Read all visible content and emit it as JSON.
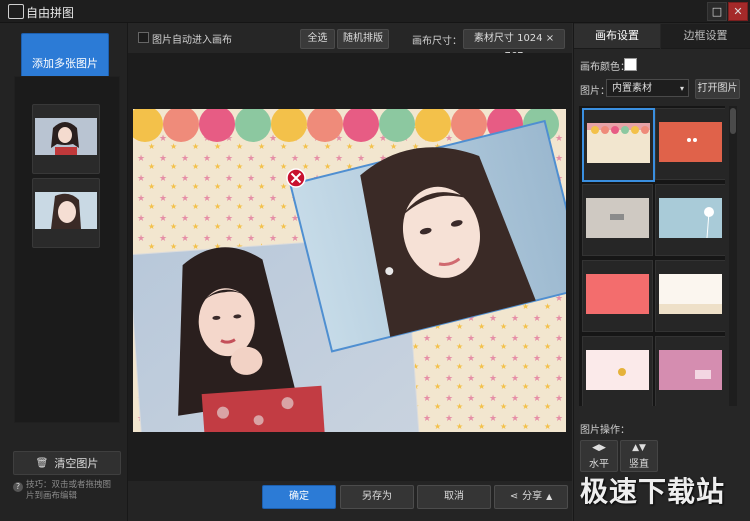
{
  "window": {
    "title": "自由拼图",
    "controls": [
      "□",
      "✕"
    ]
  },
  "left_panel": {
    "add_button": "添加多张图片",
    "clear_button": "清空图片",
    "tip_line1": "技巧：双击或者拖拽图",
    "tip_line2": "片到画布编辑"
  },
  "toolbar": {
    "auto_enter_label": "图片自动进入画布",
    "select_all": "全选",
    "random_sort": "随机排版",
    "canvas_size_label": "画布尺寸：",
    "canvas_size_value": "素材尺寸 1024 × 767"
  },
  "bottom_bar": {
    "ok": "确定",
    "save_as": "另存为",
    "cancel": "取消",
    "share": "分享"
  },
  "right_panel": {
    "tab_canvas": "画布设置",
    "tab_border": "边框设置",
    "canvas_color_label": "画布颜色：",
    "canvas_color": "#ffffff",
    "image_label": "图片：",
    "image_select": "内置素材",
    "open_image_button": "打开图片",
    "image_ops_label": "图片操作：",
    "horizontal": "水平",
    "vertical": "竖直"
  },
  "watermark": "极速下载站",
  "colors": {
    "accent": "#2c7bd6",
    "delete": "#c8102e"
  }
}
